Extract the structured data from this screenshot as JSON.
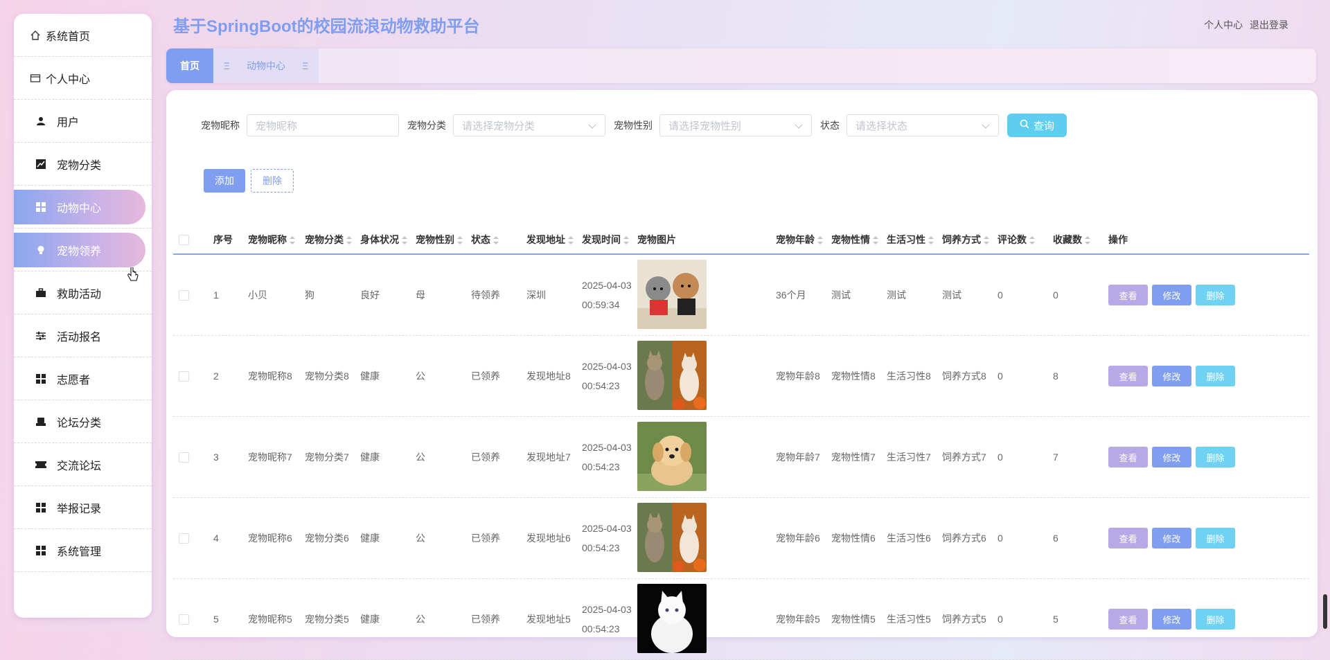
{
  "header": {
    "title": "基于SpringBoot的校园流浪动物救助平台",
    "links": [
      "个人中心",
      "退出登录"
    ]
  },
  "sidebar": {
    "items": [
      {
        "label": "系统首页",
        "icon": "home-icon"
      },
      {
        "label": "个人中心",
        "icon": "card-icon"
      },
      {
        "label": "用户",
        "icon": "user-icon"
      },
      {
        "label": "宠物分类",
        "icon": "chart-icon"
      },
      {
        "label": "动物中心",
        "icon": "grid-icon",
        "active": true
      },
      {
        "label": "宠物领养",
        "icon": "bulb-icon",
        "hover": true
      },
      {
        "label": "救助活动",
        "icon": "briefcase-icon"
      },
      {
        "label": "活动报名",
        "icon": "sliders-icon"
      },
      {
        "label": "志愿者",
        "icon": "grid-icon"
      },
      {
        "label": "论坛分类",
        "icon": "printer-icon"
      },
      {
        "label": "交流论坛",
        "icon": "ticket-icon"
      },
      {
        "label": "举报记录",
        "icon": "grid-icon"
      },
      {
        "label": "系统管理",
        "icon": "grid-icon"
      }
    ]
  },
  "tabs": {
    "home": "首页",
    "current": "动物中心"
  },
  "filters": {
    "name_label": "宠物昵称",
    "name_placeholder": "宠物昵称",
    "category_label": "宠物分类",
    "category_placeholder": "请选择宠物分类",
    "gender_label": "宠物性别",
    "gender_placeholder": "请选择宠物性别",
    "status_label": "状态",
    "status_placeholder": "请选择状态",
    "search": "查询"
  },
  "actions": {
    "add": "添加",
    "delete": "删除"
  },
  "table": {
    "headers": [
      "序号",
      "宠物昵称",
      "宠物分类",
      "身体状况",
      "宠物性别",
      "状态",
      "发现地址",
      "发现时间",
      "宠物图片",
      "宠物年龄",
      "宠物性情",
      "生活习性",
      "饲养方式",
      "评论数",
      "收藏数",
      "操作"
    ],
    "op_labels": {
      "view": "查看",
      "edit": "修改",
      "remove": "删除"
    },
    "rows": [
      {
        "no": "1",
        "name": "小贝",
        "category": "狗",
        "health": "良好",
        "gender": "母",
        "status": "待领养",
        "address": "深圳",
        "time": "2025-04-03 00:59:34",
        "image": "poodles",
        "age": "36个月",
        "temper": "测试",
        "habit": "测试",
        "feeding": "测试",
        "comments": "0",
        "favorites": "0"
      },
      {
        "no": "2",
        "name": "宠物昵称8",
        "category": "宠物分类8",
        "health": "健康",
        "gender": "公",
        "status": "已领养",
        "address": "发现地址8",
        "time": "2025-04-03 00:54:23",
        "image": "cats",
        "age": "宠物年龄8",
        "temper": "宠物性情8",
        "habit": "生活习性8",
        "feeding": "饲养方式8",
        "comments": "0",
        "favorites": "8"
      },
      {
        "no": "3",
        "name": "宠物昵称7",
        "category": "宠物分类7",
        "health": "健康",
        "gender": "公",
        "status": "已领养",
        "address": "发现地址7",
        "time": "2025-04-03 00:54:23",
        "image": "puppy",
        "age": "宠物年龄7",
        "temper": "宠物性情7",
        "habit": "生活习性7",
        "feeding": "饲养方式7",
        "comments": "0",
        "favorites": "7"
      },
      {
        "no": "4",
        "name": "宠物昵称6",
        "category": "宠物分类6",
        "health": "健康",
        "gender": "公",
        "status": "已领养",
        "address": "发现地址6",
        "time": "2025-04-03 00:54:23",
        "image": "cats",
        "age": "宠物年龄6",
        "temper": "宠物性情6",
        "habit": "生活习性6",
        "feeding": "饲养方式6",
        "comments": "0",
        "favorites": "6"
      },
      {
        "no": "5",
        "name": "宠物昵称5",
        "category": "宠物分类5",
        "health": "健康",
        "gender": "公",
        "status": "已领养",
        "address": "发现地址5",
        "time": "2025-04-03 00:54:23",
        "image": "white-cat",
        "age": "宠物年龄5",
        "temper": "宠物性情5",
        "habit": "生活习性5",
        "feeding": "饲养方式5",
        "comments": "0",
        "favorites": "5"
      }
    ]
  },
  "colors": {
    "accent": "#7f9ef0",
    "search": "#5ecdf0",
    "view": "#b7a8e8",
    "remove": "#6fd2f3"
  }
}
